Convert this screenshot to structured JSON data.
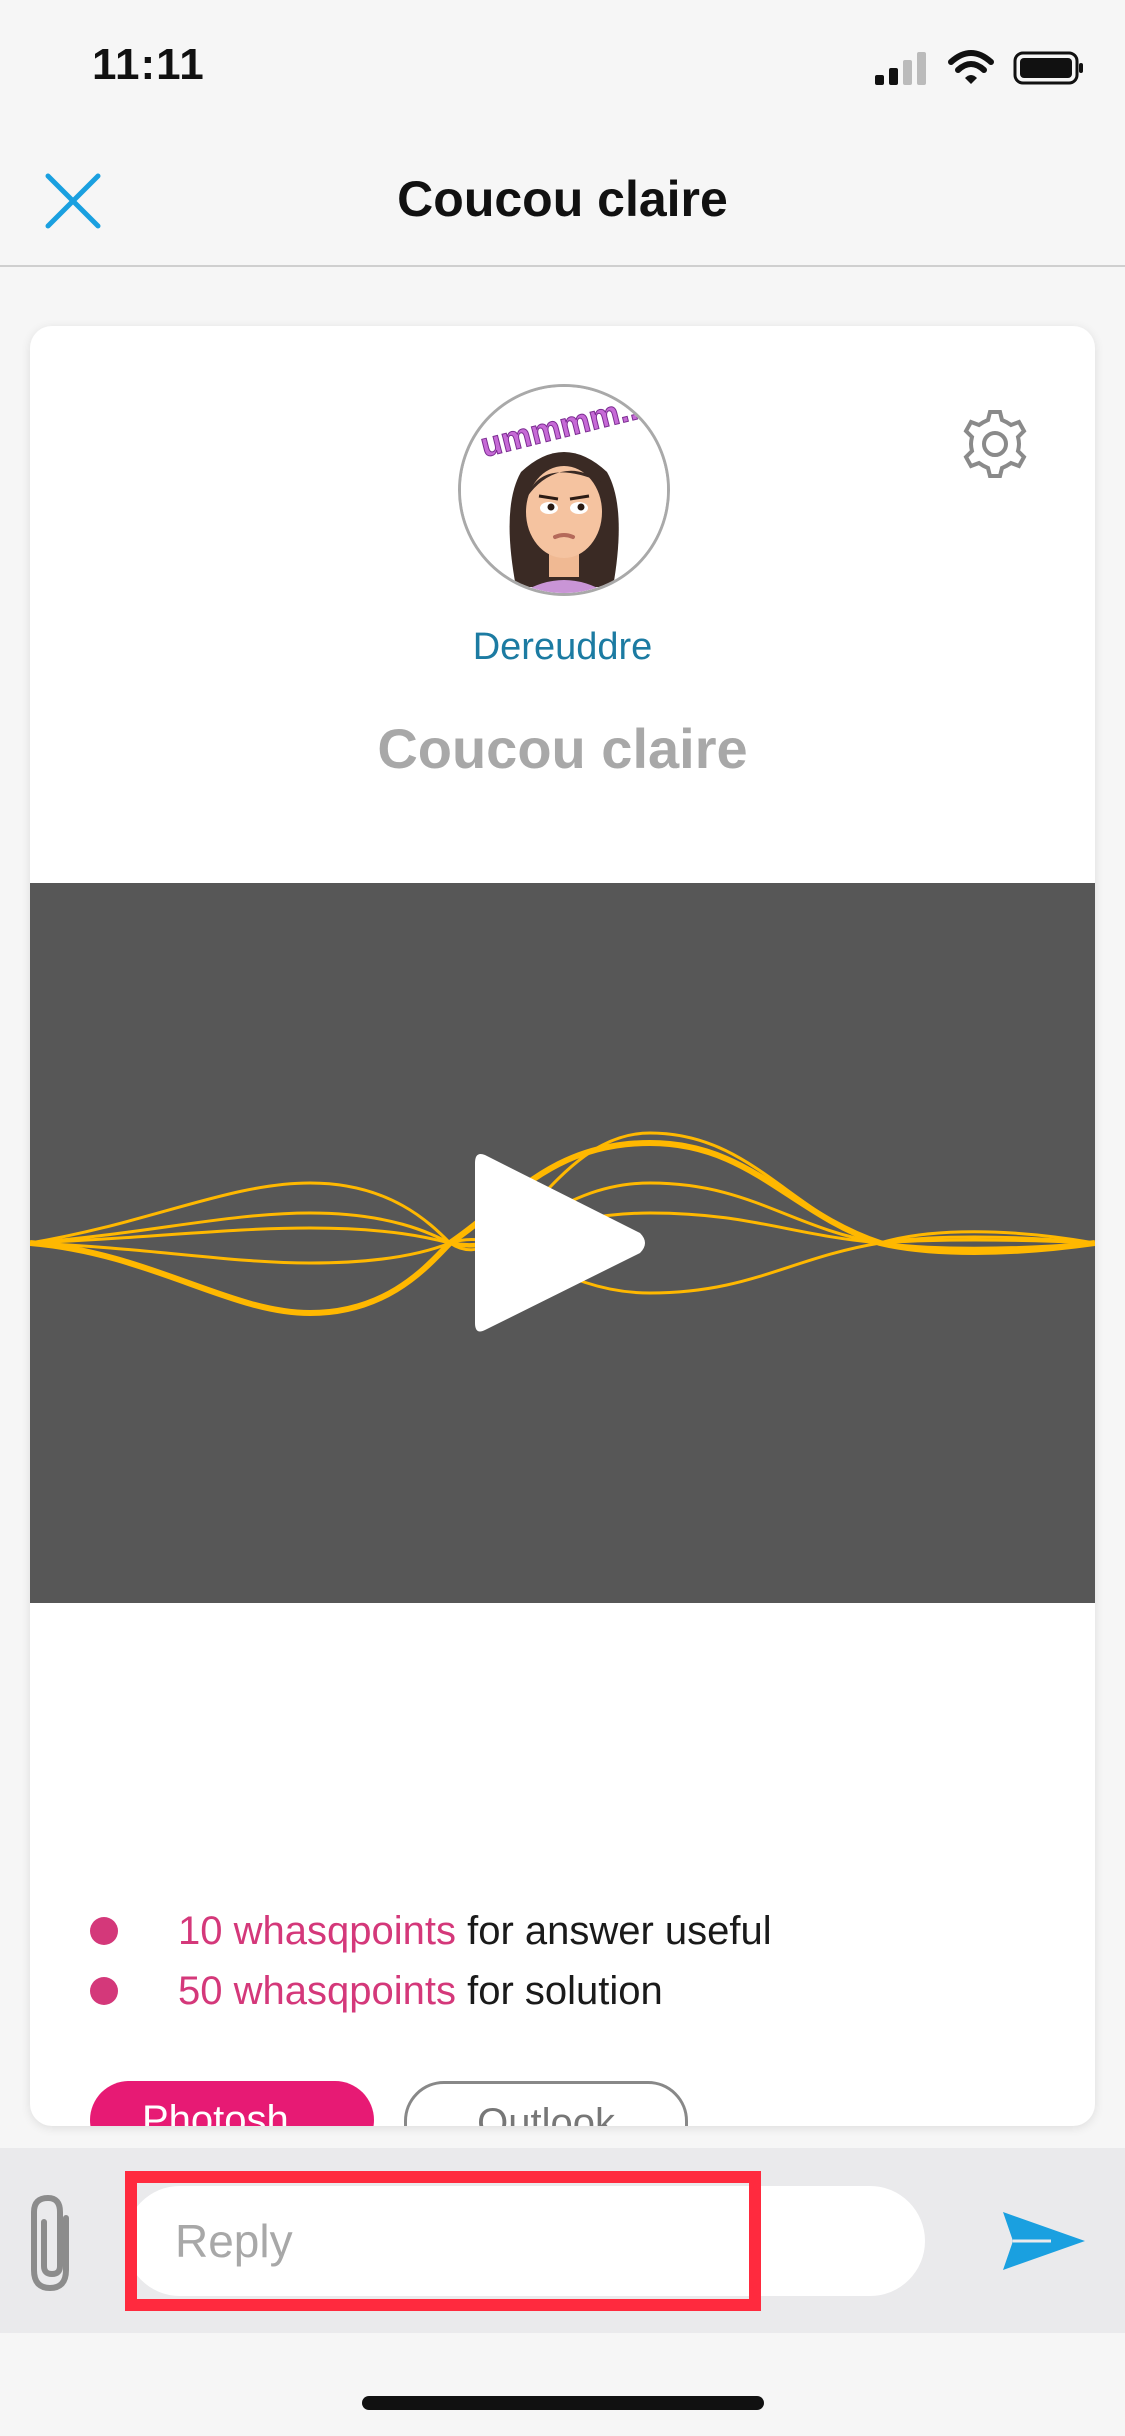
{
  "status_bar": {
    "time": "11:11"
  },
  "nav": {
    "title": "Coucou claire"
  },
  "post": {
    "author": "Dereuddre",
    "title": "Coucou claire",
    "avatar_text": "ummmm..."
  },
  "rewards": [
    {
      "points": "10 whasqpoints",
      "text": " for answer useful"
    },
    {
      "points": "50 whasqpoints",
      "text": " for solution"
    }
  ],
  "tags": [
    "Photosh...",
    "Outlook"
  ],
  "composer": {
    "placeholder": "Reply"
  },
  "colors": {
    "accent_blue": "#1aa0e0",
    "author_blue": "#1c7ba2",
    "pink": "#d4387a",
    "tag_pink": "#e71a74",
    "video_bg": "#575757",
    "wave": "#ffb800",
    "highlight": "#ff2a3e"
  }
}
